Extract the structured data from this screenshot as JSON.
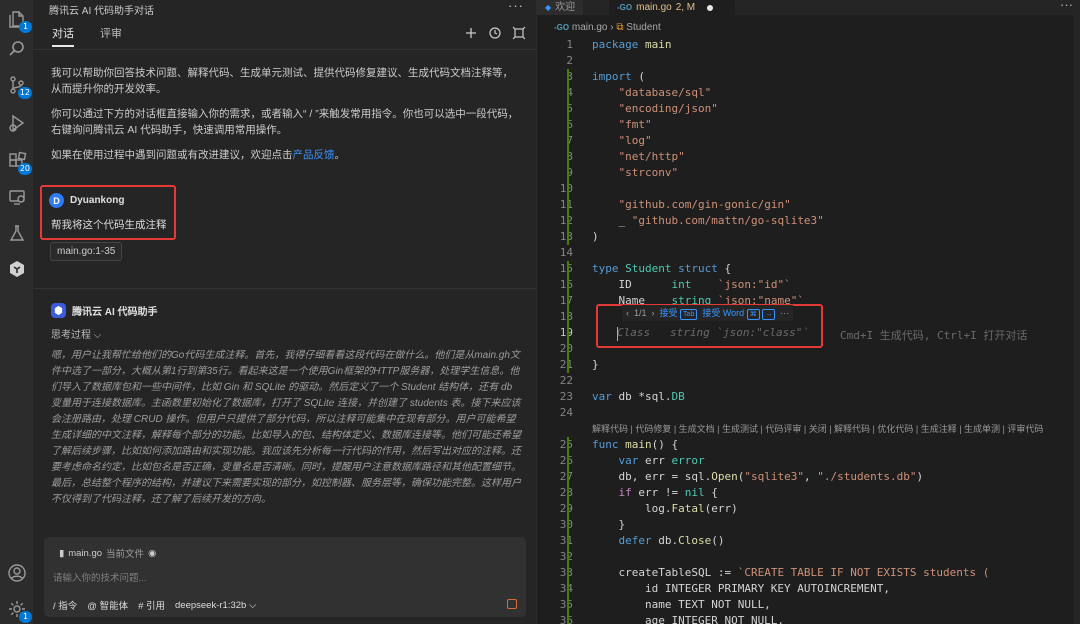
{
  "activity_bar": {
    "items": [
      {
        "icon": "files-icon",
        "badge": "1"
      },
      {
        "icon": "search-icon",
        "badge": ""
      },
      {
        "icon": "source-control-icon",
        "badge": "12"
      },
      {
        "icon": "run-debug-icon",
        "badge": ""
      },
      {
        "icon": "extensions-icon",
        "badge": "20"
      },
      {
        "icon": "remote-explorer-icon",
        "badge": ""
      },
      {
        "icon": "testing-icon",
        "badge": ""
      },
      {
        "icon": "tencent-ai-icon",
        "badge": ""
      }
    ],
    "bottom": [
      {
        "icon": "account-icon",
        "badge": ""
      },
      {
        "icon": "settings-gear-icon",
        "badge": "1"
      }
    ]
  },
  "chat": {
    "title": "腾讯云 AI 代码助手对话",
    "tabs": [
      "对话",
      "评审"
    ],
    "intro": [
      "我可以帮助你回答技术问题、解释代码、生成单元测试、提供代码修复建议、生成代码文档注释等，从而提升你的开发效率。",
      "你可以通过下方的对话框直接输入你的需求，或者输入“ / ”来触发常用指令。你也可以选中一段代码，右键询问腾讯云 AI 代码助手，快速调用常用操作。"
    ],
    "feedback_prefix": "如果在使用过程中遇到问题或有改进建议，欢迎点击",
    "feedback_link": "产品反馈",
    "feedback_suffix": "。",
    "user": {
      "initial": "D",
      "name": "Dyuankong",
      "message": "帮我将这个代码生成注释",
      "file_ref": "main.go:1-35"
    },
    "assistant": {
      "name": "腾讯云 AI 代码助手",
      "thinking_label": "思考过程",
      "thinking": "嗯，用户让我帮忙给他们的Go代码生成注释。首先，我得仔细看看这段代码在做什么。他们是从main.gh文件中选了一部分，大概从第1行到第35行。看起来这是一个使用Gin框架的HTTP服务器，处理学生信息。他们导入了数据库包和一些中间件，比如 Gin 和 SQLite 的驱动。然后定义了一个 Student 结构体，还有 db 变量用于连接数据库。主函数里初始化了数据库，打开了 SQLite 连接，并创建了 students 表。接下来应该会注册路由，处理 CRUD 操作。但用户只提供了部分代码，所以注释可能集中在现有部分。用户可能希望生成详细的中文注释，解释每个部分的功能。比如导入的包、结构体定义、数据库连接等。他们可能还希望了解后续步骤，比如如何添加路由和实现功能。我应该先分析每一行代码的作用，然后写出对应的注释。还要考虑命名约定，比如包名是否正确，变量名是否清晰。同时，提醒用户注意数据库路径和其他配置细节。最后，总结整个程序的结构，并建议下来需要实现的部分，如控制器、服务层等，确保功能完整。这样用户不仅得到了代码注释，还了解了后续开发的方向。"
    },
    "input": {
      "context_file": "main.go",
      "context_label": "当前文件",
      "placeholder": "请输入你的技术问题...",
      "commands": [
        "/ 指令",
        "@ 智能体",
        "# 引用"
      ],
      "model": "deepseek-r1:32b"
    }
  },
  "editor": {
    "tabs": [
      {
        "label": "欢迎",
        "active": false
      },
      {
        "label": "main.go",
        "status": "2, M",
        "active": true
      }
    ],
    "breadcrumb": [
      "main.go",
      "Student"
    ],
    "lens_actions": "解释代码 | 代码修复 | 生成文档 | 生成测试 | 代码评审 | 关闭 | 解释代码 | 优化代码 | 生成注释 | 生成单测 | 评审代码",
    "suggestion_bar": {
      "counter": "1/1",
      "accept": "接受",
      "accept_key": "Tab",
      "accept_word": "接受 Word",
      "more": "···"
    },
    "inline_hint": "Cmd+I 生成代码, Ctrl+I 打开对话",
    "lines": [
      {
        "n": "1",
        "code": "package main"
      },
      {
        "n": "2",
        "code": ""
      },
      {
        "n": "3",
        "code": "import ("
      },
      {
        "n": "4",
        "code": "    \"database/sql\""
      },
      {
        "n": "5",
        "code": "    \"encoding/json\""
      },
      {
        "n": "6",
        "code": "    \"fmt\""
      },
      {
        "n": "7",
        "code": "    \"log\""
      },
      {
        "n": "8",
        "code": "    \"net/http\""
      },
      {
        "n": "9",
        "code": "    \"strconv\""
      },
      {
        "n": "10",
        "code": ""
      },
      {
        "n": "11",
        "code": "    \"github.com/gin-gonic/gin\""
      },
      {
        "n": "12",
        "code": "    _ \"github.com/mattn/go-sqlite3\""
      },
      {
        "n": "13",
        "code": ")"
      },
      {
        "n": "14",
        "code": ""
      },
      {
        "n": "15",
        "code": "type Student struct {"
      },
      {
        "n": "16",
        "code": "    ID      int    `json:\"id\"`"
      },
      {
        "n": "17",
        "code": "    Name    string `json:\"name\"`"
      },
      {
        "n": "18",
        "code": ""
      },
      {
        "n": "19",
        "code": "    Class   string `json:\"class\"`"
      },
      {
        "n": "20",
        "code": ""
      },
      {
        "n": "21",
        "code": "}"
      },
      {
        "n": "22",
        "code": ""
      },
      {
        "n": "23",
        "code": "var db *sql.DB"
      },
      {
        "n": "24",
        "code": ""
      },
      {
        "n": "25",
        "code": "func main() {"
      },
      {
        "n": "26",
        "code": "    var err error"
      },
      {
        "n": "27",
        "code": "    db, err = sql.Open(\"sqlite3\", \"./students.db\")"
      },
      {
        "n": "28",
        "code": "    if err != nil {"
      },
      {
        "n": "29",
        "code": "        log.Fatal(err)"
      },
      {
        "n": "30",
        "code": "    }"
      },
      {
        "n": "31",
        "code": "    defer db.Close()"
      },
      {
        "n": "32",
        "code": ""
      },
      {
        "n": "33",
        "code": "    createTableSQL := `CREATE TABLE IF NOT EXISTS students ("
      },
      {
        "n": "34",
        "code": "        id INTEGER PRIMARY KEY AUTOINCREMENT,"
      },
      {
        "n": "35",
        "code": "        name TEXT NOT NULL,"
      },
      {
        "n": "36",
        "code": "        age INTEGER NOT NULL,"
      }
    ]
  },
  "colors": {
    "accent": "#0078d4",
    "highlight_box": "#e53935",
    "link": "#3794ff"
  }
}
